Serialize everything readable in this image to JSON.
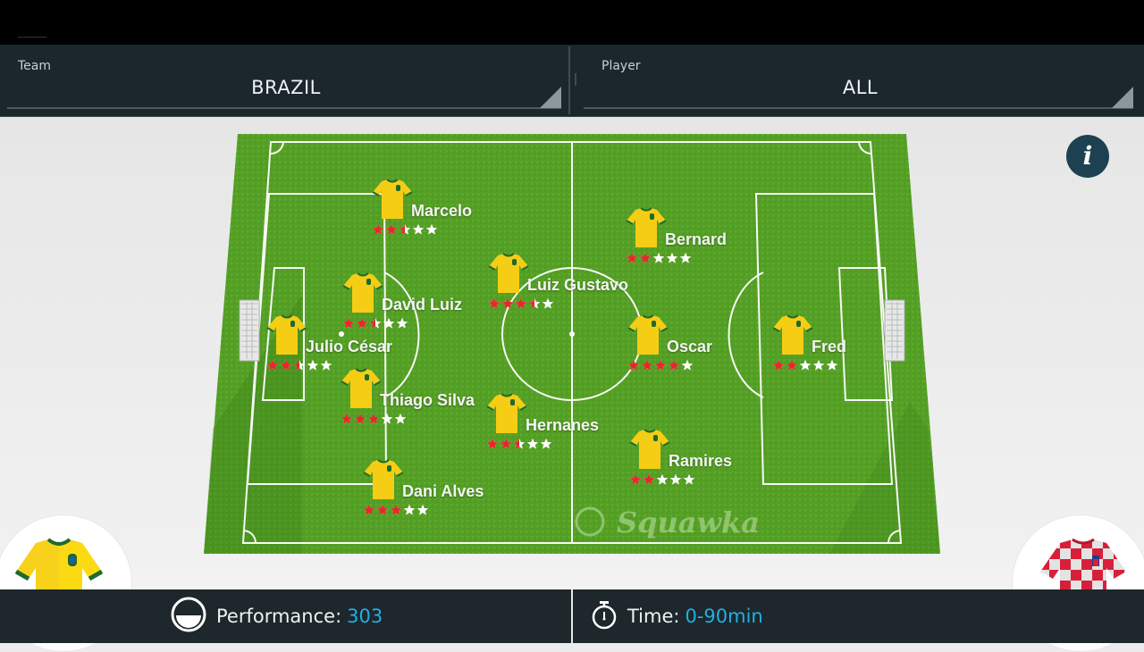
{
  "filters": {
    "team": {
      "label": "Team",
      "value": "BRAZIL"
    },
    "player": {
      "label": "Player",
      "value": "ALL"
    }
  },
  "info_button": {
    "label": "i",
    "icon": "info-icon"
  },
  "pitch": {
    "watermark": "Squawka",
    "colors": {
      "grass": "#4f9a22",
      "lines": "#ffffff",
      "shirt": "#f5cd14",
      "shirt_trim": "#1d6a2e",
      "star_on": "#e8262b",
      "star_off": "#ffffff"
    },
    "players": [
      {
        "name": "Marcelo",
        "rating": 2.5
      },
      {
        "name": "David Luiz",
        "rating": 2.5
      },
      {
        "name": "Julio César",
        "rating": 2.5
      },
      {
        "name": "Thiago Silva",
        "rating": 3
      },
      {
        "name": "Dani Alves",
        "rating": 3
      },
      {
        "name": "Luiz Gustavo",
        "rating": 3.5
      },
      {
        "name": "Hernanes",
        "rating": 2.5
      },
      {
        "name": "Bernard",
        "rating": 2
      },
      {
        "name": "Oscar",
        "rating": 4
      },
      {
        "name": "Ramires",
        "rating": 2
      },
      {
        "name": "Fred",
        "rating": 2
      }
    ],
    "max_rating": 5
  },
  "footer": {
    "performance": {
      "label": "Performance:",
      "value": "303",
      "icon": "performance-gauge-icon"
    },
    "time": {
      "label": "Time:",
      "value": "0-90min",
      "icon": "stopwatch-icon"
    },
    "home_kit": {
      "team": "Brazil",
      "icon": "brazil-shirt-icon"
    },
    "away_kit": {
      "team": "Croatia",
      "icon": "croatia-shirt-icon"
    },
    "accent_color": "#22aee5"
  }
}
